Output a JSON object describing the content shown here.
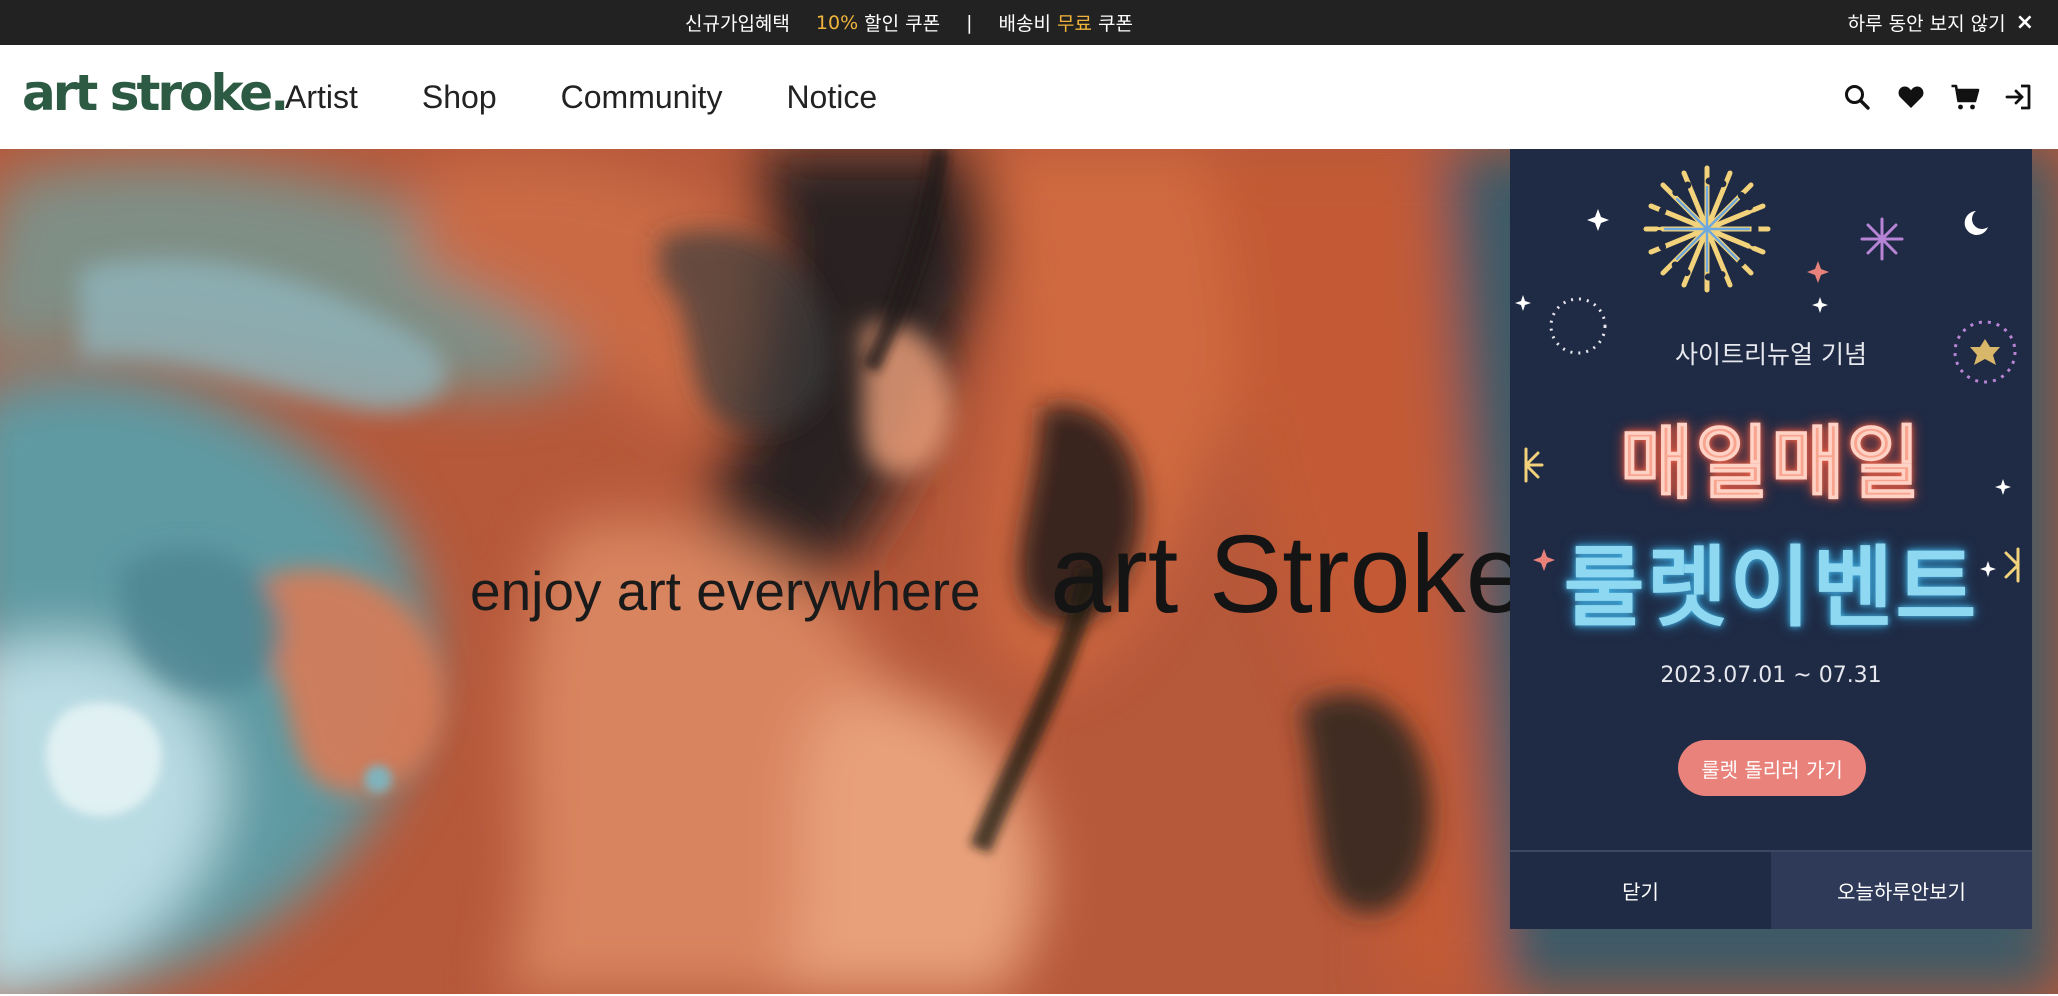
{
  "promo": {
    "part1": "신규가입혜택",
    "part2_highlight": "10%",
    "part2": " 할인 쿠폰",
    "separator": "|",
    "part3": "배송비 ",
    "part3_highlight": "무료",
    "part3_end": " 쿠폰",
    "dismiss_label": "하루 동안 보지 않기",
    "dismiss_icon": "×"
  },
  "header": {
    "logo": "art stroke.",
    "nav": [
      "Artist",
      "Shop",
      "Community",
      "Notice"
    ],
    "icons": [
      "search-icon",
      "heart-icon",
      "cart-icon",
      "login-icon"
    ]
  },
  "hero": {
    "tagline": "enjoy art everywhere",
    "title": "art Stroke"
  },
  "popup": {
    "subtitle": "사이트리뉴얼 기념",
    "title_line1": "매일매일",
    "title_line2": "룰렛이벤트",
    "date_range": "2023.07.01 ~ 07.31",
    "cta_label": "룰렛 돌리러 가기",
    "close_label": "닫기",
    "hide_today_label": "오늘하루안보기"
  },
  "colors": {
    "promo_bg": "#222222",
    "promo_highlight": "#f0b43c",
    "logo": "#2d5a43",
    "popup_bg": "#1f2a44",
    "popup_cta": "#e8827a",
    "neon_pink": "#f9a48f",
    "neon_blue": "#8ed8f2"
  }
}
